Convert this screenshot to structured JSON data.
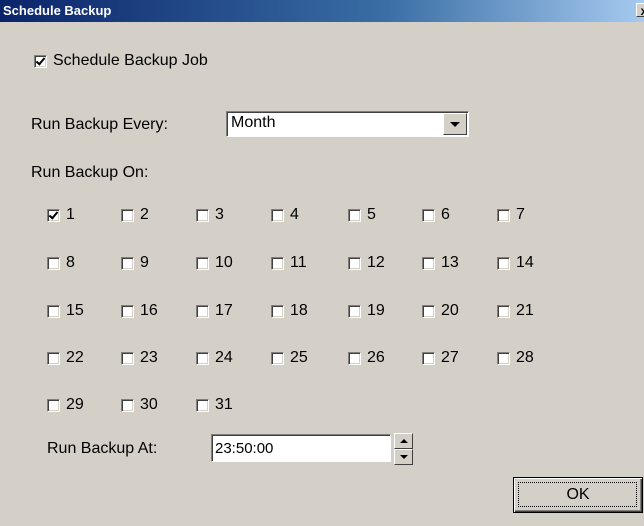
{
  "window": {
    "title": "Schedule Backup",
    "close_label": "x"
  },
  "schedule": {
    "label": "Schedule Backup Job",
    "checked": true
  },
  "every": {
    "label": "Run Backup Every:",
    "value": "Month"
  },
  "on": {
    "label": "Run Backup On:",
    "days": [
      {
        "label": "1",
        "checked": true
      },
      {
        "label": "2",
        "checked": false
      },
      {
        "label": "3",
        "checked": false
      },
      {
        "label": "4",
        "checked": false
      },
      {
        "label": "5",
        "checked": false
      },
      {
        "label": "6",
        "checked": false
      },
      {
        "label": "7",
        "checked": false
      },
      {
        "label": "8",
        "checked": false
      },
      {
        "label": "9",
        "checked": false
      },
      {
        "label": "10",
        "checked": false
      },
      {
        "label": "11",
        "checked": false
      },
      {
        "label": "12",
        "checked": false
      },
      {
        "label": "13",
        "checked": false
      },
      {
        "label": "14",
        "checked": false
      },
      {
        "label": "15",
        "checked": false
      },
      {
        "label": "16",
        "checked": false
      },
      {
        "label": "17",
        "checked": false
      },
      {
        "label": "18",
        "checked": false
      },
      {
        "label": "19",
        "checked": false
      },
      {
        "label": "20",
        "checked": false
      },
      {
        "label": "21",
        "checked": false
      },
      {
        "label": "22",
        "checked": false
      },
      {
        "label": "23",
        "checked": false
      },
      {
        "label": "24",
        "checked": false
      },
      {
        "label": "25",
        "checked": false
      },
      {
        "label": "26",
        "checked": false
      },
      {
        "label": "27",
        "checked": false
      },
      {
        "label": "28",
        "checked": false
      },
      {
        "label": "29",
        "checked": false
      },
      {
        "label": "30",
        "checked": false
      },
      {
        "label": "31",
        "checked": false
      }
    ]
  },
  "at": {
    "label": "Run Backup At:",
    "value": "23:50:00"
  },
  "ok": {
    "label": "OK"
  }
}
